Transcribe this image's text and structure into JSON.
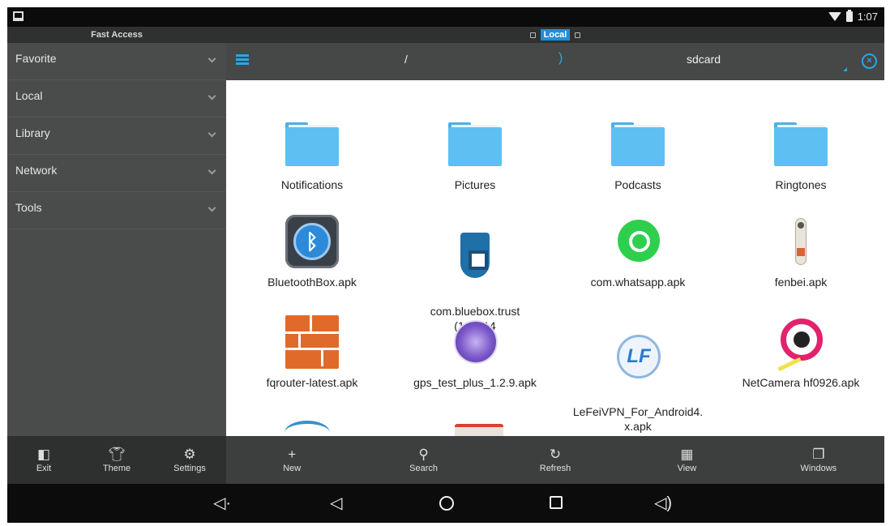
{
  "status_bar": {
    "time": "1:07"
  },
  "sidebar": {
    "title": "Fast Access",
    "items": [
      {
        "label": "Favorite"
      },
      {
        "label": "Local"
      },
      {
        "label": "Library"
      },
      {
        "label": "Network"
      },
      {
        "label": "Tools"
      }
    ]
  },
  "header": {
    "active_tab": "Local",
    "path_root": "/",
    "path_separator": ")",
    "path_current": "sdcard"
  },
  "files": [
    {
      "name": "Notifications",
      "icon": "folder-icon"
    },
    {
      "name": "Pictures",
      "icon": "folder-icon"
    },
    {
      "name": "Podcasts",
      "icon": "folder-icon"
    },
    {
      "name": "Ringtones",
      "icon": "folder-icon"
    },
    {
      "name": "BluetoothBox.apk",
      "icon": "bluetooth-app-icon"
    },
    {
      "name": "com.bluebox.trust\n(120314",
      "icon": "bluebox-shield-icon"
    },
    {
      "name": "com.whatsapp.apk",
      "icon": "whatsapp-icon"
    },
    {
      "name": "fenbei.apk",
      "icon": "sound-meter-icon"
    },
    {
      "name": "fqrouter-latest.apk",
      "icon": "brick-wall-icon"
    },
    {
      "name": "gps_test_plus_1.2.9.apk",
      "icon": "gps-globe-icon"
    },
    {
      "name": "LeFeiVPN_For_Android4.\nx.apk",
      "icon": "lefei-vpn-icon"
    },
    {
      "name": "NetCamera hf0926.apk",
      "icon": "camera-icon"
    }
  ],
  "side_toolbar": [
    {
      "label": "Exit",
      "icon": "exit-icon"
    },
    {
      "label": "Theme",
      "icon": "shirt-icon"
    },
    {
      "label": "Settings",
      "icon": "gear-icon"
    }
  ],
  "main_toolbar": [
    {
      "label": "New",
      "icon": "plus-icon"
    },
    {
      "label": "Search",
      "icon": "search-icon"
    },
    {
      "label": "Refresh",
      "icon": "refresh-icon"
    },
    {
      "label": "View",
      "icon": "grid-icon"
    },
    {
      "label": "Windows",
      "icon": "windows-icon"
    }
  ],
  "colors": {
    "accent": "#29a6e6",
    "folder": "#5ec0f2",
    "sidebar_bg": "#4a4b4b",
    "toolbar_bg": "#3d3e3e"
  }
}
